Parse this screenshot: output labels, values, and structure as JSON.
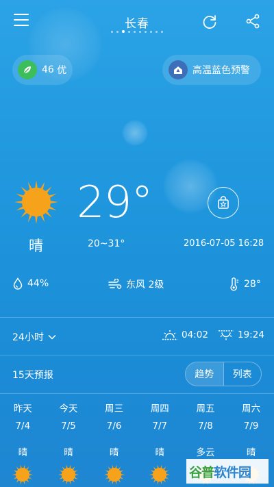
{
  "header": {
    "city": "长春",
    "page_count": 11,
    "active_page": 3
  },
  "aqi": {
    "value": "46",
    "level": "优",
    "color": "#3cbf5a"
  },
  "warning": {
    "text": "高温蓝色预警",
    "color": "#3d6fb8"
  },
  "current": {
    "temperature": "29°",
    "condition": "晴",
    "range": "20~31°",
    "datetime": "2016-07-05 16:28"
  },
  "stats": {
    "humidity": "44%",
    "wind": "东风 2级",
    "feels_like": "28°"
  },
  "hourly": {
    "label": "24小时",
    "sunrise": "04:02",
    "sunset": "19:24"
  },
  "daily": {
    "label": "15天预报",
    "view_options": [
      "趋势",
      "列表"
    ],
    "active_view": 0,
    "days": [
      {
        "name": "昨天",
        "date": "7/4",
        "condition": "晴",
        "icon": "sun-icon"
      },
      {
        "name": "今天",
        "date": "7/5",
        "condition": "晴",
        "icon": "sun-icon"
      },
      {
        "name": "周三",
        "date": "7/6",
        "condition": "晴",
        "icon": "sun-icon"
      },
      {
        "name": "周四",
        "date": "7/7",
        "condition": "晴",
        "icon": "sun-icon"
      },
      {
        "name": "周五",
        "date": "7/8",
        "condition": "多云",
        "icon": "cloud-icon"
      },
      {
        "name": "周六",
        "date": "7/9",
        "condition": "晴",
        "icon": "sun-icon"
      }
    ]
  },
  "watermark": {
    "part1": "谷普",
    "part2": "软件园"
  },
  "colors": {
    "sun": "#f7a21b",
    "background_top": "#2ba3e6",
    "background_bottom": "#1f86d2"
  }
}
